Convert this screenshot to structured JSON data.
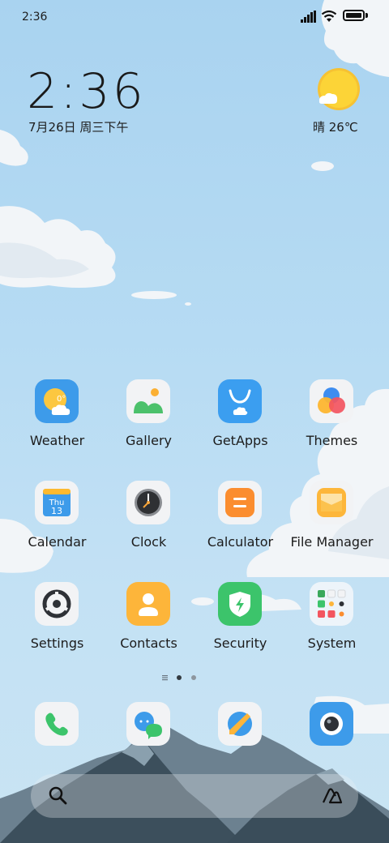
{
  "status_bar": {
    "time": "2:36"
  },
  "widget": {
    "time": "2:36",
    "date": "7月26日 周三下午",
    "weather": "晴 26℃"
  },
  "apps": [
    {
      "name": "Weather",
      "icon": "weather-icon"
    },
    {
      "name": "Gallery",
      "icon": "gallery-icon"
    },
    {
      "name": "GetApps",
      "icon": "getapps-icon"
    },
    {
      "name": "Themes",
      "icon": "themes-icon"
    },
    {
      "name": "Calendar",
      "icon": "calendar-icon"
    },
    {
      "name": "Clock",
      "icon": "clock-icon"
    },
    {
      "name": "Calculator",
      "icon": "calculator-icon"
    },
    {
      "name": "File Manager",
      "icon": "file-manager-icon"
    },
    {
      "name": "Settings",
      "icon": "settings-icon"
    },
    {
      "name": "Contacts",
      "icon": "contacts-icon"
    },
    {
      "name": "Security",
      "icon": "security-icon"
    },
    {
      "name": "System",
      "icon": "folder-icon"
    }
  ],
  "weather_icon_text": "0°",
  "calendar_icon": {
    "day": "Thu",
    "date": "13"
  },
  "dock": [
    {
      "icon": "phone-icon"
    },
    {
      "icon": "messaging-icon"
    },
    {
      "icon": "browser-icon"
    },
    {
      "icon": "camera-icon"
    }
  ],
  "colors": {
    "sky": "#b6dbf3",
    "accent_blue": "#3d9bea",
    "green": "#45c06b",
    "orange": "#fb8d2f"
  }
}
